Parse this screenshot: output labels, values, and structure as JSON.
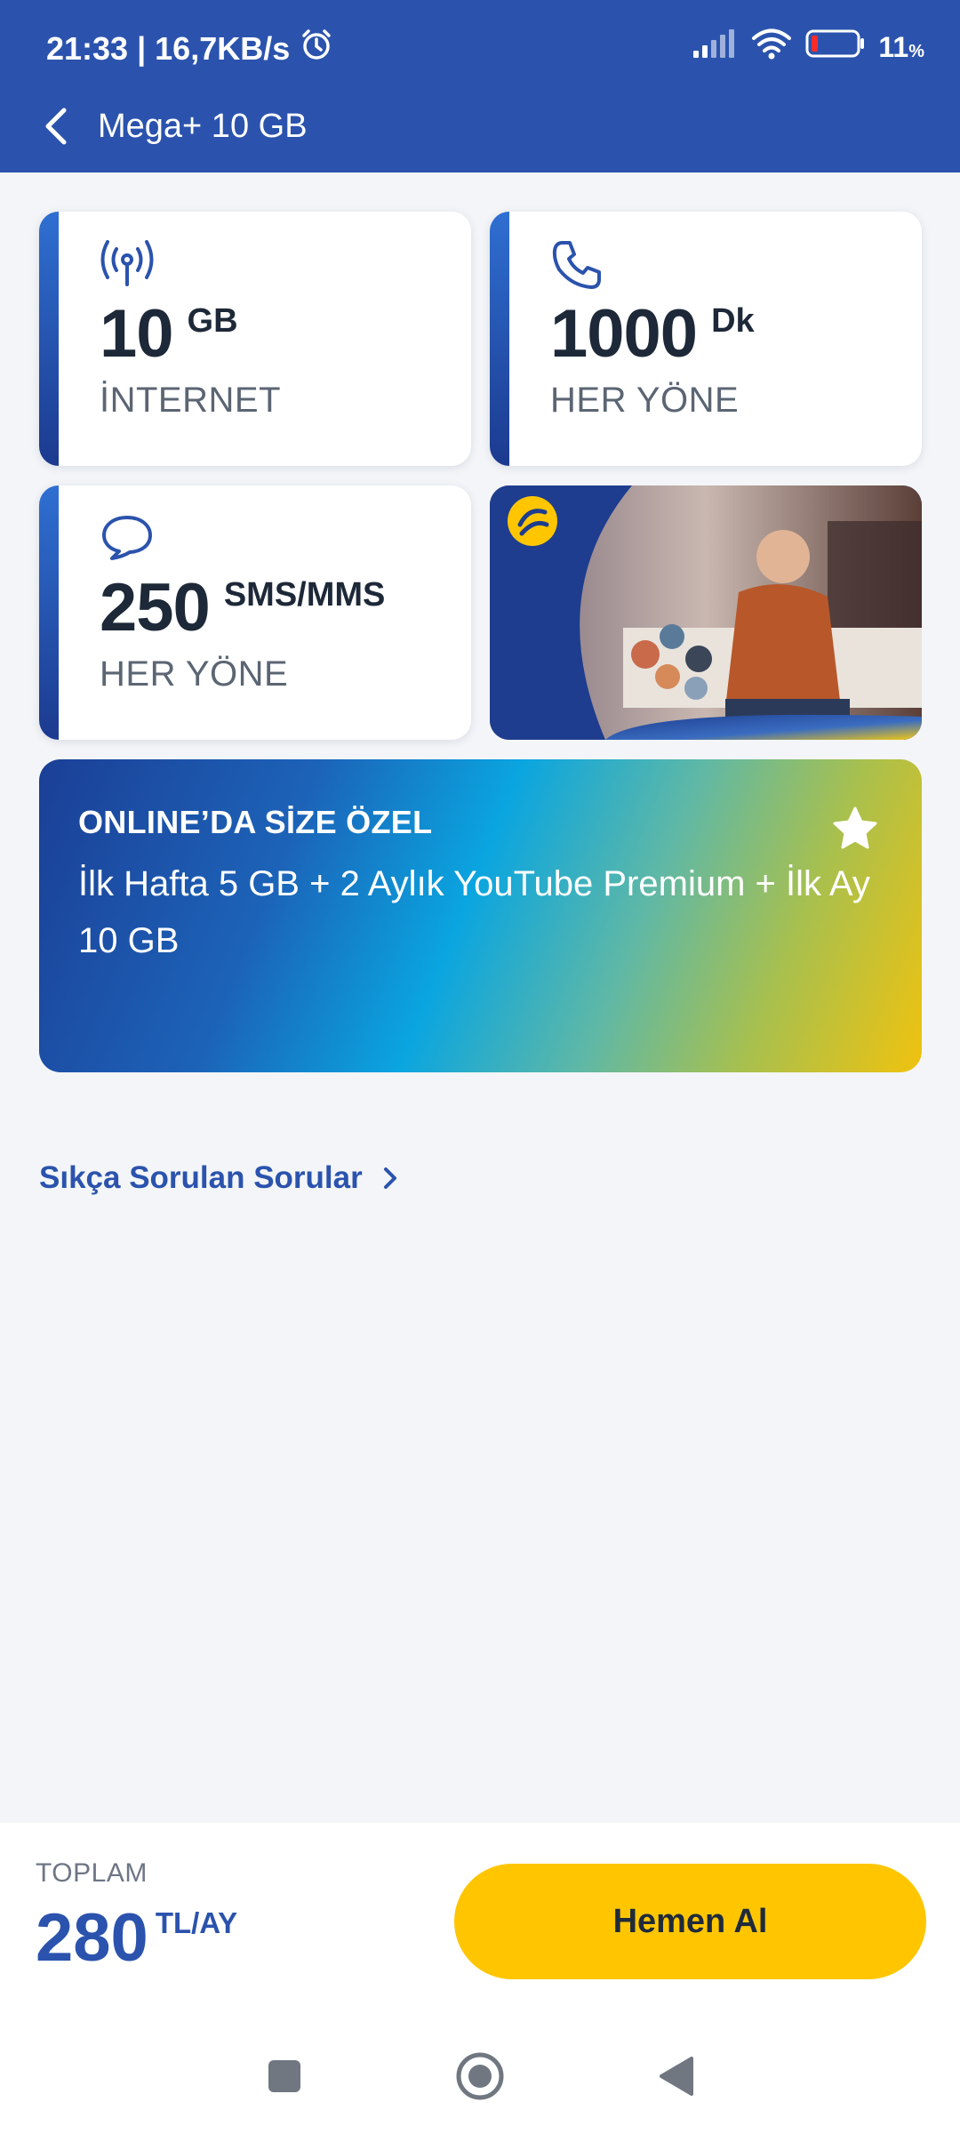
{
  "status_bar": {
    "time": "21:33",
    "network_speed": "16,7KB/s",
    "battery": "11",
    "battery_unit": "%"
  },
  "header": {
    "title": "Mega+ 10 GB"
  },
  "cards": {
    "internet": {
      "value": "10",
      "unit": "GB",
      "label": "İNTERNET"
    },
    "minutes": {
      "value": "1000",
      "unit": "Dk",
      "label": "HER YÖNE"
    },
    "sms": {
      "value": "250",
      "unit": "SMS/MMS",
      "label": "HER YÖNE"
    }
  },
  "banner": {
    "title": "ONLINE’DA SİZE ÖZEL",
    "description": "İlk Hafta 5 GB + 2 Aylık YouTube Premium + İlk Ay 10 GB"
  },
  "faq": {
    "label": "Sıkça Sorulan Sorular"
  },
  "footer": {
    "total_label": "TOPLAM",
    "total_value": "280",
    "total_unit": "TL/AY",
    "buy_button": "Hemen Al"
  },
  "colors": {
    "header": "#2b53ad",
    "accent_yellow": "#ffc600",
    "brand_blue": "#2b53ad"
  }
}
